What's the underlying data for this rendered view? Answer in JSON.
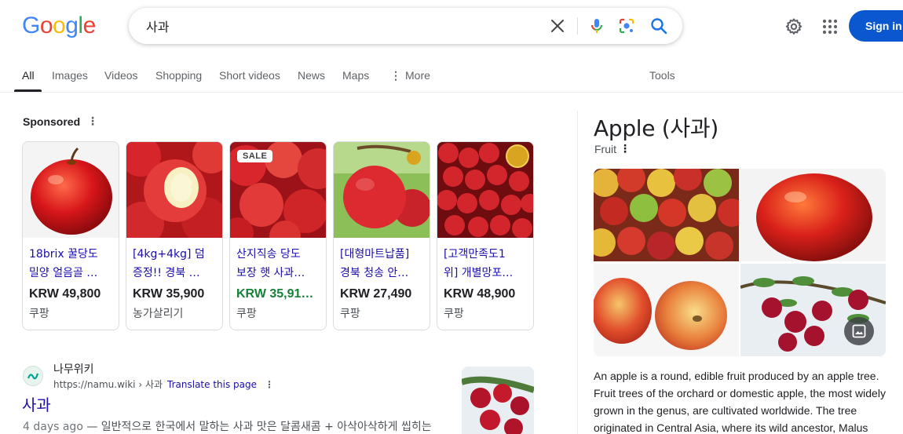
{
  "header": {
    "logo_letters": [
      {
        "ch": "G",
        "color": "#4285F4"
      },
      {
        "ch": "o",
        "color": "#EA4335"
      },
      {
        "ch": "o",
        "color": "#FBBC05"
      },
      {
        "ch": "g",
        "color": "#4285F4"
      },
      {
        "ch": "l",
        "color": "#34A853"
      },
      {
        "ch": "e",
        "color": "#EA4335"
      }
    ],
    "search_value": "사과",
    "signin_label": "Sign in"
  },
  "tabs": {
    "all": "All",
    "images": "Images",
    "videos": "Videos",
    "shopping": "Shopping",
    "short_videos": "Short videos",
    "news": "News",
    "maps": "Maps",
    "more": "More",
    "tools": "Tools"
  },
  "sponsored": {
    "label": "Sponsored",
    "cards": [
      {
        "title1": "18brix 꿀당도",
        "title2": "밀양 얼음골 …",
        "price": "KRW 49,800",
        "seller": "쿠팡",
        "green": false
      },
      {
        "title1": "[4kg+4kg] 덤",
        "title2": "증정!! 경북 …",
        "price": "KRW 35,900",
        "seller": "농가살리기",
        "green": false
      },
      {
        "title1": "산지직송 당도",
        "title2": "보장 햇 사과…",
        "price": "KRW 35,91…",
        "seller": "쿠팡",
        "green": true,
        "badge": "SALE"
      },
      {
        "title1": "[대형마트납품]",
        "title2": "경북 청송 안…",
        "price": "KRW 27,490",
        "seller": "쿠팡",
        "green": false
      },
      {
        "title1": "[고객만족도1",
        "title2": "위] 개별망포…",
        "price": "KRW 48,900",
        "seller": "쿠팡",
        "green": false
      }
    ]
  },
  "result": {
    "site_name": "나무위키",
    "url": "https://namu.wiki › 사과",
    "translate": "Translate this page",
    "title": "사과",
    "date": "4 days ago",
    "snippet": " — 일반적으로 한국에서 말하는 사과 맛은 달콤새콤 + 아삭아삭하게 씹히는"
  },
  "knowledge_panel": {
    "title": "Apple (사과)",
    "subtitle": "Fruit",
    "description_lines": [
      "An apple is a round, edible fruit produced by an apple tree.",
      "Fruit trees of the orchard or domestic apple, the most widely",
      "grown in the genus, are cultivated worldwide. The tree",
      "originated in Central Asia, where its wild ancestor, Malus"
    ]
  },
  "colors": {
    "link_blue": "#1a0dab",
    "signin_blue": "#0b57d0",
    "price_green": "#188038"
  }
}
